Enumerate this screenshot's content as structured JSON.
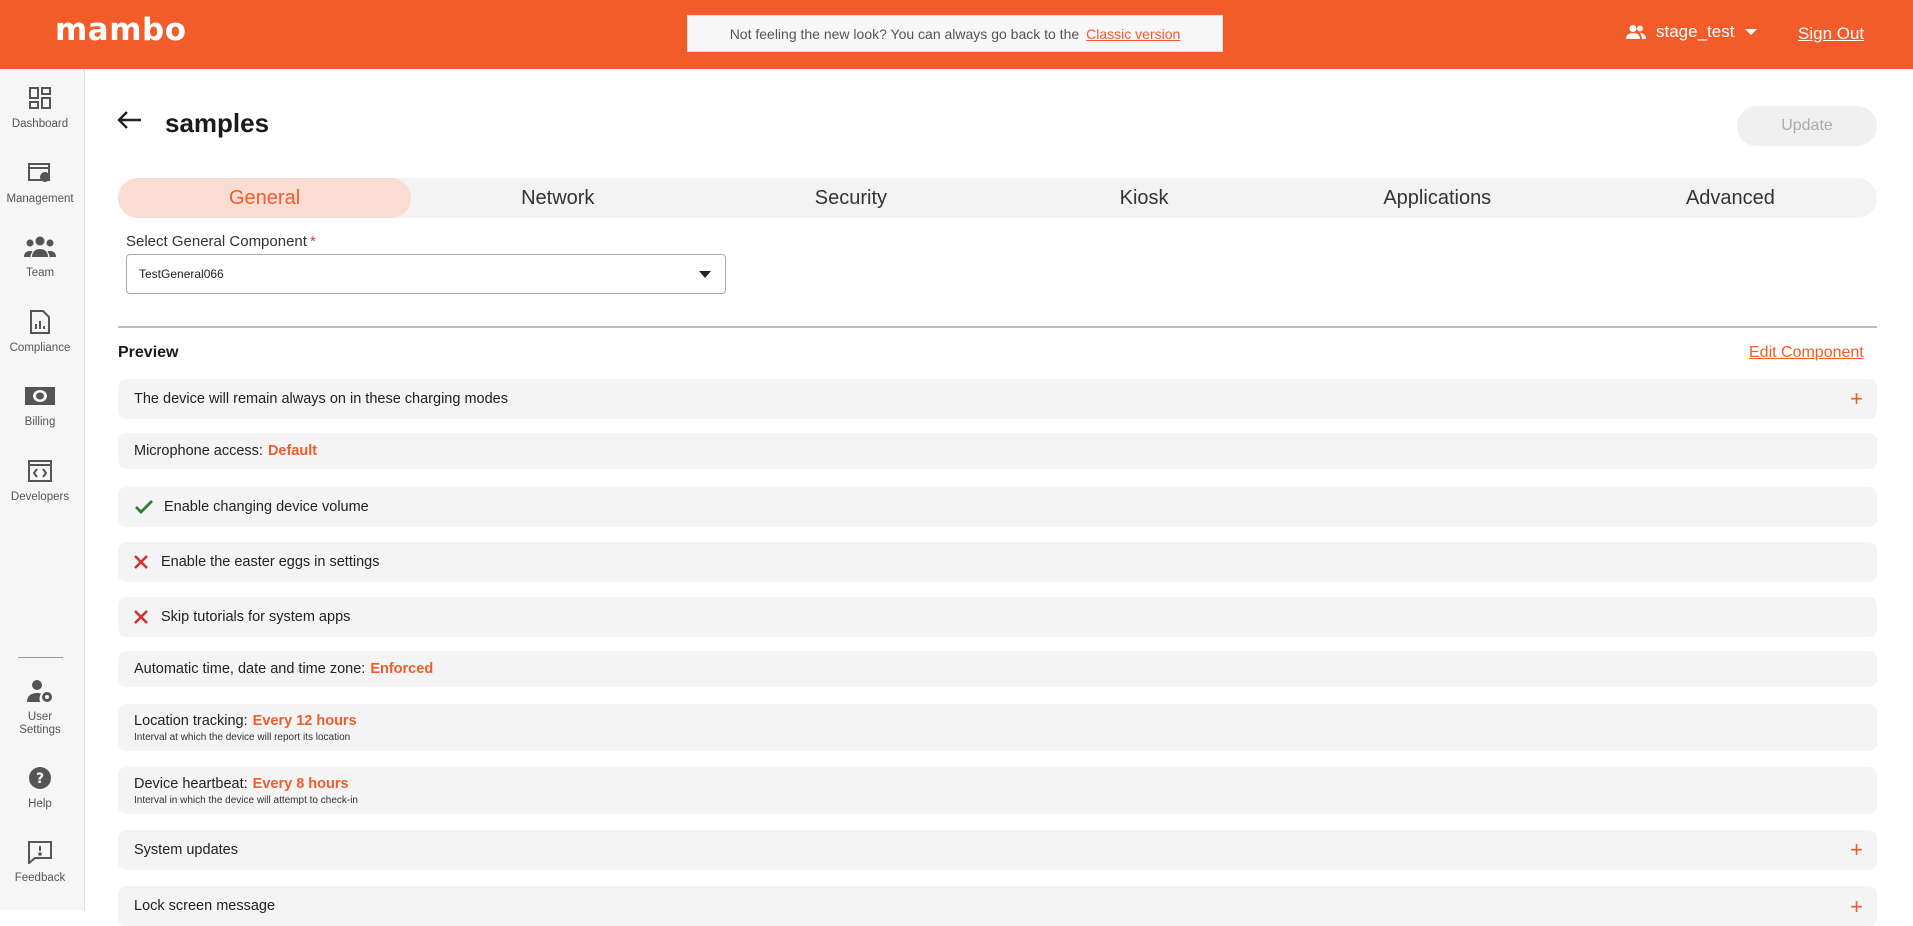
{
  "header": {
    "logo": "mambo",
    "notice_text": "Not feeling the new look? You can always go back to the",
    "notice_link": "Classic version",
    "username": "stage_test",
    "sign_out": "Sign Out"
  },
  "sidebar": {
    "items": [
      {
        "label": "Dashboard"
      },
      {
        "label": "Management"
      },
      {
        "label": "Team"
      },
      {
        "label": "Compliance"
      },
      {
        "label": "Billing"
      },
      {
        "label": "Developers"
      },
      {
        "label": "User Settings"
      },
      {
        "label": "Help"
      },
      {
        "label": "Feedback"
      }
    ]
  },
  "page": {
    "title": "samples",
    "update_label": "Update"
  },
  "tabs": [
    {
      "label": "General",
      "active": true
    },
    {
      "label": "Network"
    },
    {
      "label": "Security"
    },
    {
      "label": "Kiosk"
    },
    {
      "label": "Applications"
    },
    {
      "label": "Advanced"
    }
  ],
  "component_select": {
    "label": "Select General Component",
    "required_mark": "*",
    "value": "TestGeneral066"
  },
  "preview": {
    "heading": "Preview",
    "edit_link": "Edit Component",
    "rows": [
      {
        "text": "The device will remain always on in these charging modes",
        "expandable": true
      },
      {
        "text": "Microphone access:",
        "value": "Default"
      },
      {
        "text": "Enable changing device volume",
        "status": "enabled"
      },
      {
        "text": "Enable the easter eggs in settings",
        "status": "disabled"
      },
      {
        "text": "Skip tutorials for system apps",
        "status": "disabled"
      },
      {
        "text": "Automatic time, date and time zone:",
        "value": "Enforced"
      },
      {
        "text": "Location tracking:",
        "value": "Every 12 hours",
        "subtext": "Interval at which the device will report its location"
      },
      {
        "text": "Device heartbeat:",
        "value": "Every 8 hours",
        "subtext": "Interval in which the device will attempt to check-in"
      },
      {
        "text": "System updates",
        "expandable": true
      },
      {
        "text": "Lock screen message",
        "expandable": true
      }
    ]
  },
  "colors": {
    "accent": "#f25c2b",
    "enabled_check": "#2e7d32",
    "disabled_x": "#d32f2f"
  }
}
